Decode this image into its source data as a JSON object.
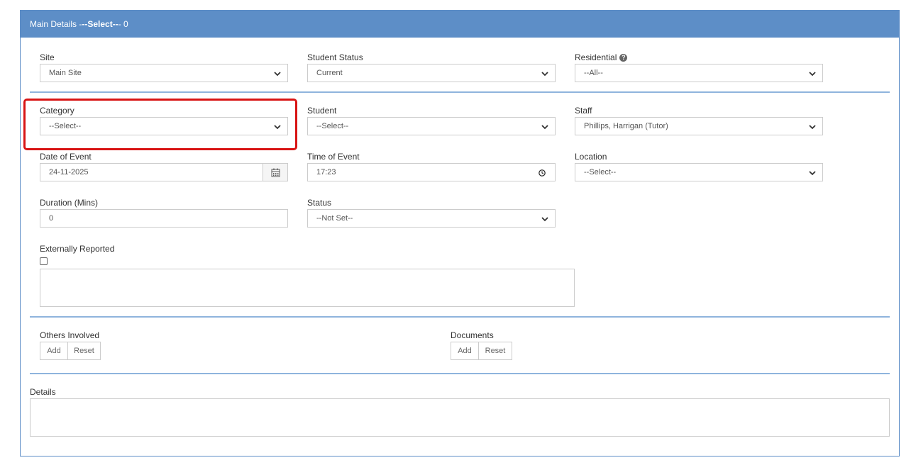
{
  "header": {
    "prefix": "Main Details - ",
    "selected": "--Select--",
    "suffix": " - 0"
  },
  "fields": {
    "site": {
      "label": "Site",
      "value": "Main Site"
    },
    "student_status": {
      "label": "Student Status",
      "value": "Current"
    },
    "residential": {
      "label": "Residential",
      "value": "--All--",
      "help_icon": "question-circle-icon"
    },
    "category": {
      "label": "Category",
      "value": "--Select--"
    },
    "student": {
      "label": "Student",
      "value": "--Select--"
    },
    "staff": {
      "label": "Staff",
      "value": "Phillips, Harrigan (Tutor)"
    },
    "date_of_event": {
      "label": "Date of Event",
      "value": "24-11-2025",
      "icon": "calendar-icon"
    },
    "time_of_event": {
      "label": "Time of Event",
      "value": "17:23",
      "icon": "clock-icon"
    },
    "location": {
      "label": "Location",
      "value": "--Select--"
    },
    "duration": {
      "label": "Duration (Mins)",
      "value": "0"
    },
    "status": {
      "label": "Status",
      "value": "--Not Set--"
    },
    "externally_reported": {
      "label": "Externally Reported",
      "checked": false
    }
  },
  "others_involved": {
    "label": "Others Involved",
    "add": "Add",
    "reset": "Reset"
  },
  "documents": {
    "label": "Documents",
    "add": "Add",
    "reset": "Reset"
  },
  "details": {
    "label": "Details"
  },
  "colors": {
    "header_bg": "#5d8ec7",
    "highlight": "#d81414"
  }
}
